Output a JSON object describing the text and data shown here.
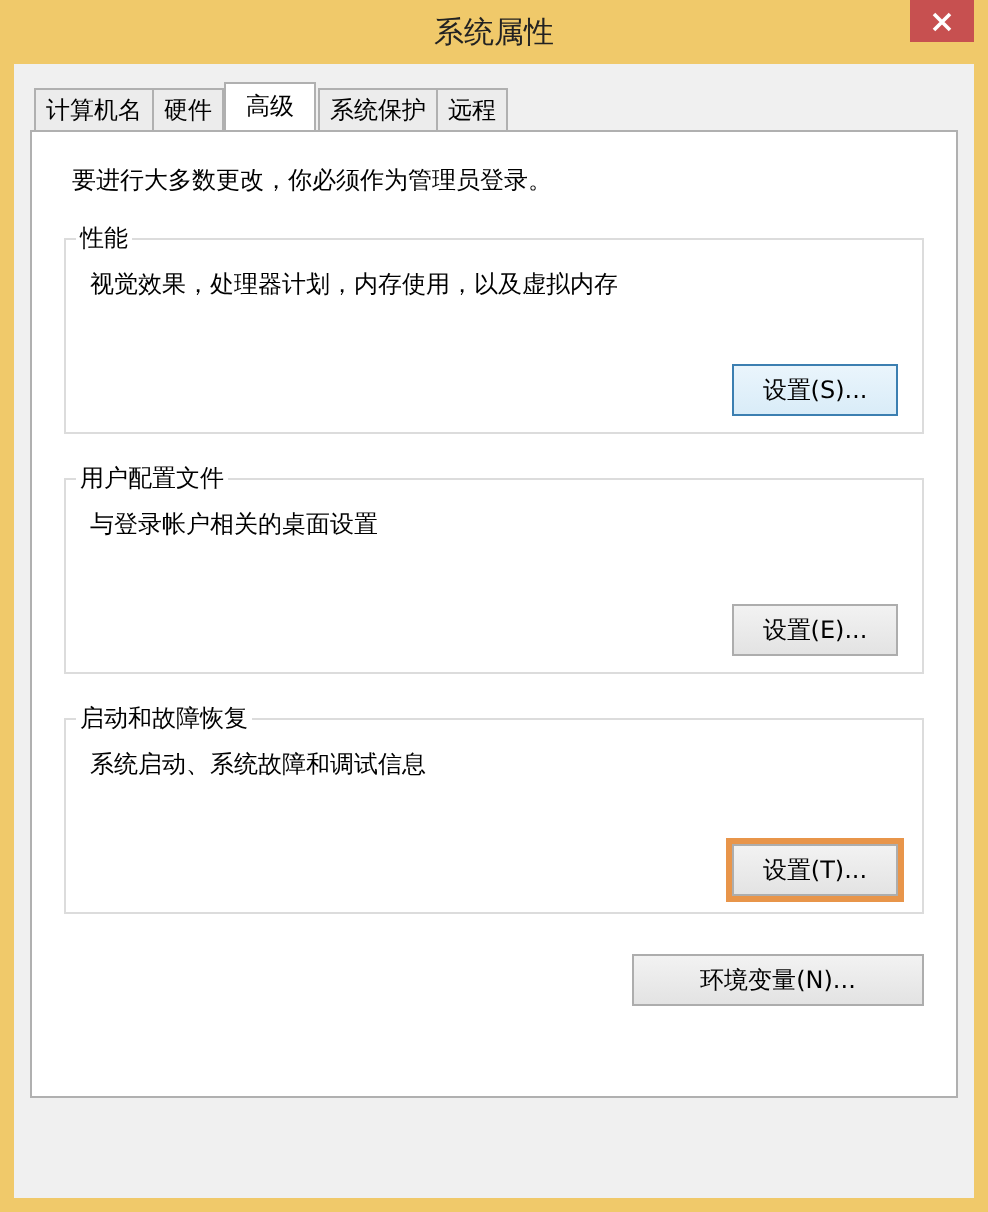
{
  "window": {
    "title": "系统属性"
  },
  "tabs": [
    {
      "label": "计算机名",
      "selected": false
    },
    {
      "label": "硬件",
      "selected": false
    },
    {
      "label": "高级",
      "selected": true
    },
    {
      "label": "系统保护",
      "selected": false
    },
    {
      "label": "远程",
      "selected": false
    }
  ],
  "notice": "要进行大多数更改，你必须作为管理员登录。",
  "groups": [
    {
      "title": "性能",
      "description": "视觉效果，处理器计划，内存使用，以及虚拟内存",
      "button": {
        "label": "设置(S)...",
        "default": true,
        "highlighted": false
      }
    },
    {
      "title": "用户配置文件",
      "description": "与登录帐户相关的桌面设置",
      "button": {
        "label": "设置(E)...",
        "default": false,
        "highlighted": false
      }
    },
    {
      "title": "启动和故障恢复",
      "description": "系统启动、系统故障和调试信息",
      "button": {
        "label": "设置(T)...",
        "default": false,
        "highlighted": true
      }
    }
  ],
  "env_button": "环境变量(N)..."
}
